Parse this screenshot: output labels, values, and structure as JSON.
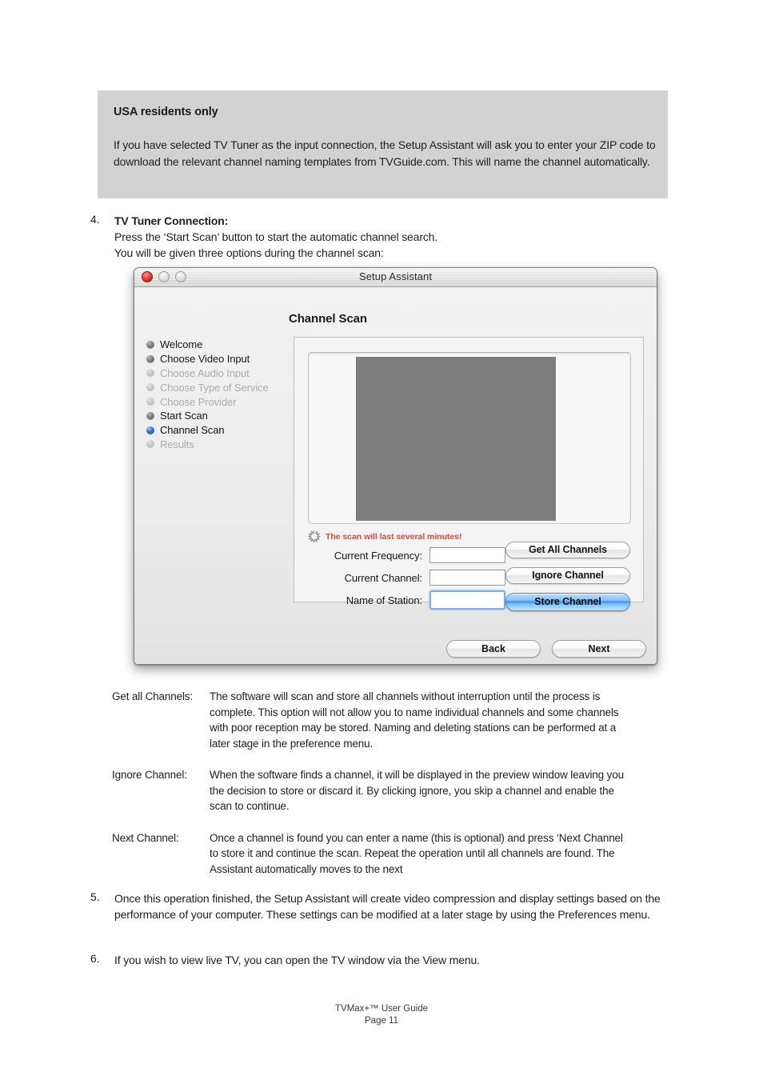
{
  "note": {
    "title": "USA residents only",
    "body": "If you have selected TV Tuner as the input connection, the Setup Assistant will ask you  to enter your ZIP code to download the relevant channel naming templates from TVGuide.com. This will name the channel automatically."
  },
  "steps": {
    "four": {
      "marker": "4.",
      "heading": "TV Tuner Connection:",
      "line1": "Press the ‘Start Scan’ button to start the automatic channel search.",
      "line2": "You will be given three options during the channel scan:"
    },
    "five": {
      "marker": "5.",
      "text": "Once this operation finished, the Setup Assistant will create video compression and display settings based on the performance of your computer. These settings can be modified at a later stage by using the Preferences menu."
    },
    "six": {
      "marker": "6.",
      "text": "If you wish to view live TV, you can open the TV window via the View menu."
    }
  },
  "window": {
    "title": "Setup Assistant",
    "pane_title": "Channel Scan",
    "traffic": {
      "close": "close-button",
      "minimize": "minimize-button",
      "zoom": "zoom-button"
    },
    "sidebar": [
      {
        "label": "Welcome",
        "state": "done"
      },
      {
        "label": "Choose Video Input",
        "state": "done"
      },
      {
        "label": "Choose Audio Input",
        "state": "todo"
      },
      {
        "label": "Choose Type of Service",
        "state": "todo"
      },
      {
        "label": "Choose Provider",
        "state": "todo"
      },
      {
        "label": "Start Scan",
        "state": "done"
      },
      {
        "label": "Channel Scan",
        "state": "current"
      },
      {
        "label": "Results",
        "state": "todo"
      }
    ],
    "scan_message": "The scan will last several minutes!",
    "fields": [
      {
        "label": "Current Frequency:",
        "value": "",
        "placeholder": ""
      },
      {
        "label": "Current Channel:",
        "value": "",
        "placeholder": ""
      },
      {
        "label": "Name of Station:",
        "value": "",
        "placeholder": ""
      }
    ],
    "action_buttons": [
      {
        "label": "Get All Channels",
        "style": "normal"
      },
      {
        "label": "Ignore Channel",
        "style": "normal"
      },
      {
        "label": "Store Channel",
        "style": "default"
      }
    ],
    "nav_buttons": [
      {
        "label": "Back"
      },
      {
        "label": "Next"
      }
    ],
    "colors": {
      "default_button_blue": "#3a94ee",
      "current_step_blue": "#3a77d4",
      "warning_red": "#f0403a",
      "preview_gray": "#7e7e7e",
      "note_background": "#d2d2d2"
    }
  },
  "definitions": [
    {
      "term": "Get all Channels:",
      "desc": "The software will scan and store all channels without interruption until the process is complete. This option will not allow you to name individual channels and some channels with poor reception may be stored. Naming and deleting stations can be performed at a later stage in the preference menu."
    },
    {
      "term": "Ignore Channel:",
      "desc": "When the software finds a channel, it will be displayed in the preview window leaving you the decision to store or discard it. By clicking ignore, you skip a channel and enable the scan to continue."
    },
    {
      "term": "Next Channel:",
      "desc": "Once a channel is found you can enter a name (this is optional) and press ‘Next Channel to store it and continue the scan. Repeat the operation until all channels are found. The Assistant automatically moves to the next"
    }
  ],
  "footer": {
    "line1": "TVMax+™ User Guide",
    "line2": "Page 11"
  }
}
